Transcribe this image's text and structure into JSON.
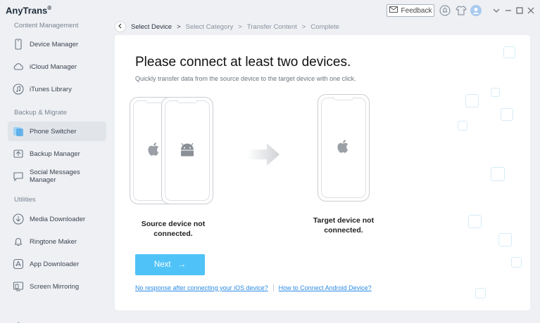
{
  "app": {
    "title": "AnyTrans",
    "trademark": "®"
  },
  "topbar": {
    "feedback_label": "Feedback"
  },
  "sidebar": {
    "sections": [
      {
        "title": "Content Management",
        "items": [
          "Device Manager",
          "iCloud Manager",
          "iTunes Library"
        ]
      },
      {
        "title": "Backup & Migrate",
        "items": [
          "Phone Switcher",
          "Backup Manager",
          "Social Messages Manager"
        ]
      },
      {
        "title": "Utilities",
        "items": [
          "Media Downloader",
          "Ringtone Maker",
          "App Downloader",
          "Screen Mirroring"
        ]
      }
    ],
    "active_item": "Phone Switcher"
  },
  "breadcrumb": {
    "steps": [
      "Select Device",
      "Select Category",
      "Transfer Content",
      "Complete"
    ],
    "separator": ">",
    "current": "Select Device"
  },
  "main": {
    "heading": "Please connect at least two devices.",
    "subheading": "Quickly transfer data from the source device to the target device with one click.",
    "source_caption_line1": "Source device not",
    "source_caption_line2": "connected.",
    "target_caption_line1": "Target device not",
    "target_caption_line2": "connected.",
    "next_label": "Next",
    "next_arrow": "→",
    "link_ios": "No response after connecting your iOS device?",
    "link_android": "How to Connect Android Device?"
  },
  "colors": {
    "accent": "#4fc3f7",
    "link": "#2b8be3",
    "active_bg": "#e1e5ea"
  }
}
